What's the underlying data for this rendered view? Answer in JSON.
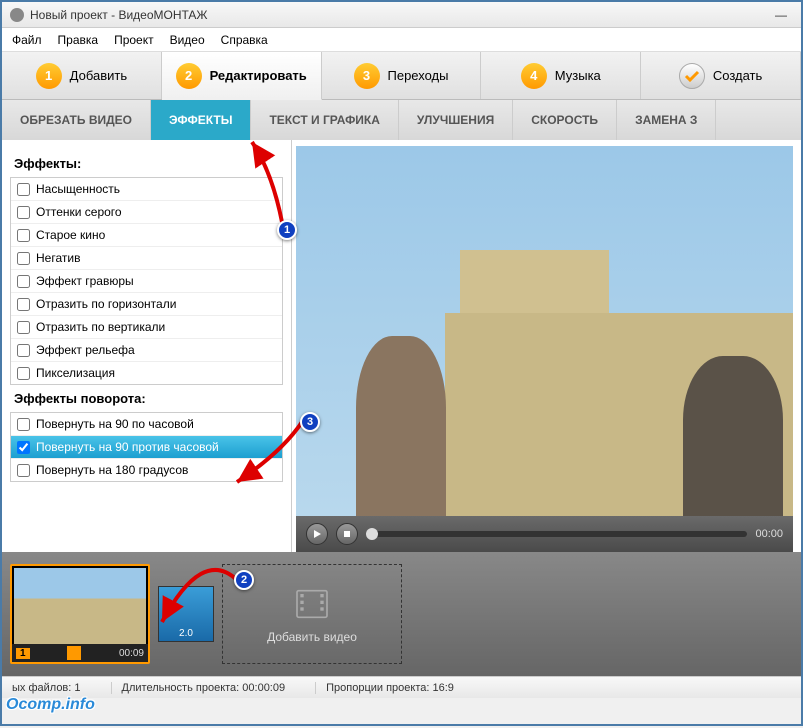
{
  "window": {
    "title": "Новый проект - ВидеоМОНТАЖ"
  },
  "menu": {
    "file": "Файл",
    "edit": "Правка",
    "project": "Проект",
    "video": "Видео",
    "help": "Справка"
  },
  "maintabs": {
    "add": "Добавить",
    "edit": "Редактировать",
    "transitions": "Переходы",
    "music": "Музыка",
    "create": "Создать"
  },
  "subtabs": {
    "crop": "ОБРЕЗАТЬ ВИДЕО",
    "effects": "ЭФФЕКТЫ",
    "text": "ТЕКСТ И ГРАФИКА",
    "enhance": "УЛУЧШЕНИЯ",
    "speed": "СКОРОСТЬ",
    "replace": "ЗАМЕНА З"
  },
  "effects": {
    "heading1": "Эффекты:",
    "list1": [
      "Насыщенность",
      "Оттенки серого",
      "Старое кино",
      "Негатив",
      "Эффект гравюры",
      "Отразить по горизонтали",
      "Отразить по вертикали",
      "Эффект рельефа",
      "Пикселизация"
    ],
    "heading2": "Эффекты поворота:",
    "list2": [
      {
        "label": "Повернуть на 90 по часовой",
        "checked": false,
        "selected": false
      },
      {
        "label": "Повернуть на 90 против часовой",
        "checked": true,
        "selected": true
      },
      {
        "label": "Повернуть на 180 градусов",
        "checked": false,
        "selected": false
      }
    ]
  },
  "player": {
    "time": "00:00"
  },
  "timeline": {
    "clip1_index": "1",
    "clip1_duration": "00:09",
    "transition_duration": "2.0",
    "add_video": "Добавить видео"
  },
  "status": {
    "files_label": "ых файлов:",
    "files_count": "1",
    "duration_label": "Длительность проекта:",
    "duration_value": "00:00:09",
    "ratio_label": "Пропорции проекта:",
    "ratio_value": "16:9"
  },
  "annotations": {
    "b1": "1",
    "b2": "2",
    "b3": "3"
  },
  "watermark": "Ocomp.info"
}
